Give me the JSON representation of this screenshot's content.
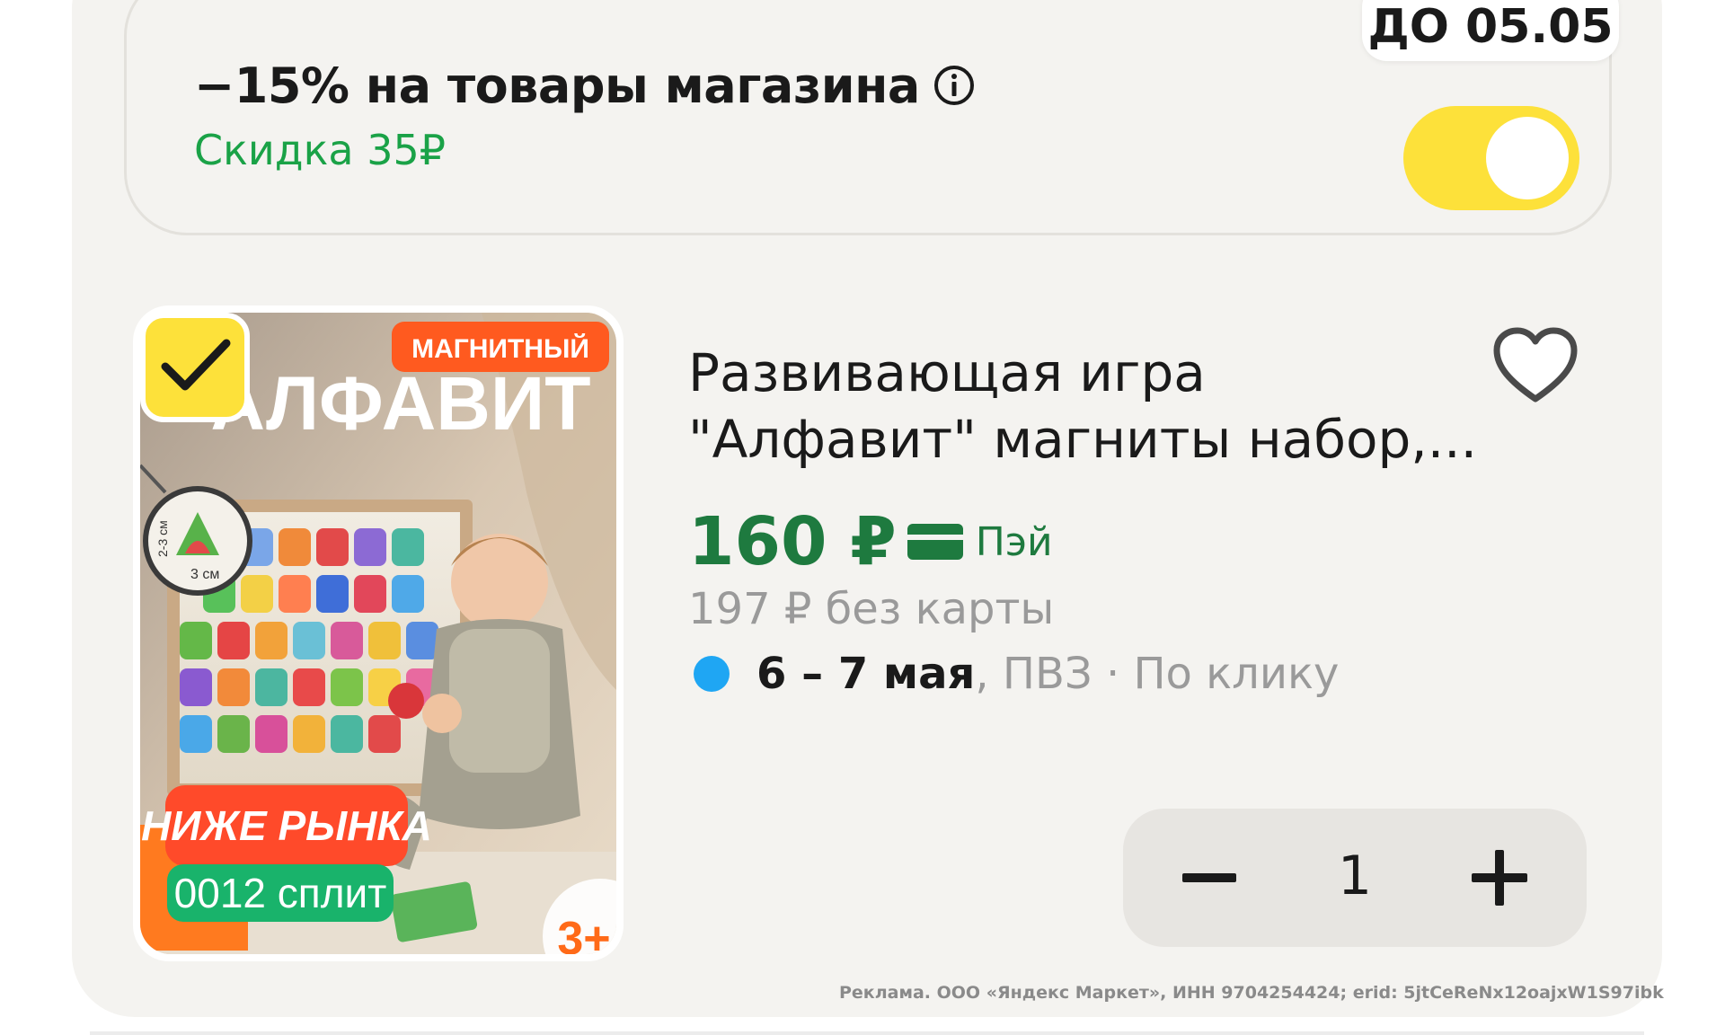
{
  "promo": {
    "title": "−15% на товары магазина",
    "discount": "Скидка 35₽",
    "date_badge": "ДО 05.05",
    "toggle_on": true
  },
  "product": {
    "title_line1": "Развивающая игра",
    "title_line2": "\"Алфавит\" магниты набор,...",
    "price": "160 ₽",
    "pay_label": "Пэй",
    "old_price": "197 ₽  без карты",
    "delivery_dates": "6 – 7 мая",
    "delivery_rest": ", ПВЗ · По клику",
    "selected": true,
    "image": {
      "badge_magnit": "МАГНИТНЫЙ",
      "headline": "АЛФАВИТ",
      "below_market": "НИЖЕ РЫНКА",
      "split": "0012 сплит",
      "age": "3+",
      "size_w": "3 см",
      "size_h": "2-3 см"
    }
  },
  "stepper": {
    "minus": "−",
    "quantity": "1",
    "plus": "+"
  },
  "ad_disclaimer": "Реклама. ООО «Яндекс Маркет», ИНН 9704254424; erid: 5jtCeReNx12oajxW1S97ibk",
  "icons": {
    "info": "info-icon",
    "check": "check-icon",
    "heart": "heart-icon",
    "card": "card-icon",
    "delivery_dot": "dot-icon"
  },
  "colors": {
    "accent_yellow": "#fde13a",
    "price_green": "#1e7a3f",
    "discount_green": "#1aa247",
    "delivery_blue": "#1fa6f3",
    "badge_orange": "#ff5a1f",
    "split_green": "#19b36b"
  }
}
